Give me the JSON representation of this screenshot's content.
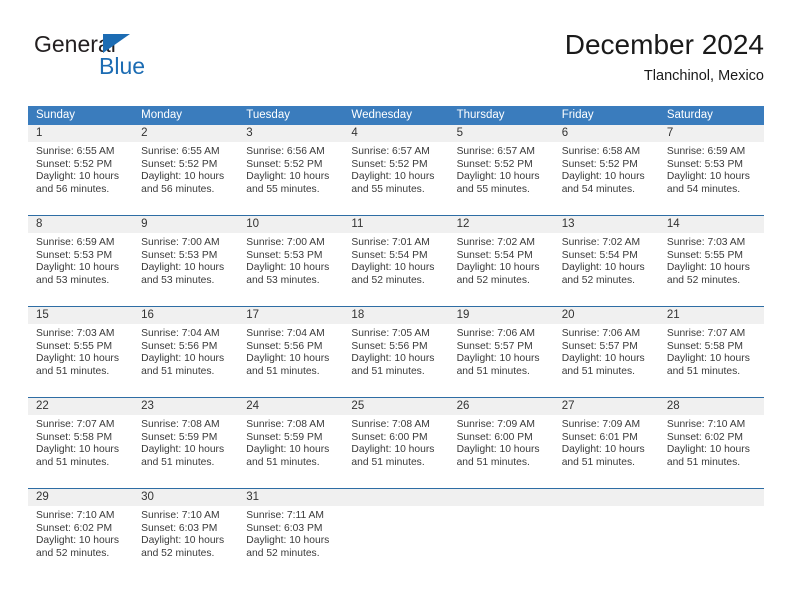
{
  "brand": {
    "name_part1": "General",
    "name_part2": "Blue",
    "triangle_color": "#1c6cb3"
  },
  "header": {
    "title": "December 2024",
    "subtitle": "Tlanchinol, Mexico"
  },
  "theme": {
    "header_blue": "#3a7cbd",
    "divider_blue": "#2e6da4",
    "daynum_band": "#f0f0f0"
  },
  "calendar": {
    "weekday_headers": [
      "Sunday",
      "Monday",
      "Tuesday",
      "Wednesday",
      "Thursday",
      "Friday",
      "Saturday"
    ],
    "weeks": [
      [
        {
          "day": "1",
          "sunrise": "Sunrise: 6:55 AM",
          "sunset": "Sunset: 5:52 PM",
          "daylight1": "Daylight: 10 hours",
          "daylight2": "and 56 minutes."
        },
        {
          "day": "2",
          "sunrise": "Sunrise: 6:55 AM",
          "sunset": "Sunset: 5:52 PM",
          "daylight1": "Daylight: 10 hours",
          "daylight2": "and 56 minutes."
        },
        {
          "day": "3",
          "sunrise": "Sunrise: 6:56 AM",
          "sunset": "Sunset: 5:52 PM",
          "daylight1": "Daylight: 10 hours",
          "daylight2": "and 55 minutes."
        },
        {
          "day": "4",
          "sunrise": "Sunrise: 6:57 AM",
          "sunset": "Sunset: 5:52 PM",
          "daylight1": "Daylight: 10 hours",
          "daylight2": "and 55 minutes."
        },
        {
          "day": "5",
          "sunrise": "Sunrise: 6:57 AM",
          "sunset": "Sunset: 5:52 PM",
          "daylight1": "Daylight: 10 hours",
          "daylight2": "and 55 minutes."
        },
        {
          "day": "6",
          "sunrise": "Sunrise: 6:58 AM",
          "sunset": "Sunset: 5:52 PM",
          "daylight1": "Daylight: 10 hours",
          "daylight2": "and 54 minutes."
        },
        {
          "day": "7",
          "sunrise": "Sunrise: 6:59 AM",
          "sunset": "Sunset: 5:53 PM",
          "daylight1": "Daylight: 10 hours",
          "daylight2": "and 54 minutes."
        }
      ],
      [
        {
          "day": "8",
          "sunrise": "Sunrise: 6:59 AM",
          "sunset": "Sunset: 5:53 PM",
          "daylight1": "Daylight: 10 hours",
          "daylight2": "and 53 minutes."
        },
        {
          "day": "9",
          "sunrise": "Sunrise: 7:00 AM",
          "sunset": "Sunset: 5:53 PM",
          "daylight1": "Daylight: 10 hours",
          "daylight2": "and 53 minutes."
        },
        {
          "day": "10",
          "sunrise": "Sunrise: 7:00 AM",
          "sunset": "Sunset: 5:53 PM",
          "daylight1": "Daylight: 10 hours",
          "daylight2": "and 53 minutes."
        },
        {
          "day": "11",
          "sunrise": "Sunrise: 7:01 AM",
          "sunset": "Sunset: 5:54 PM",
          "daylight1": "Daylight: 10 hours",
          "daylight2": "and 52 minutes."
        },
        {
          "day": "12",
          "sunrise": "Sunrise: 7:02 AM",
          "sunset": "Sunset: 5:54 PM",
          "daylight1": "Daylight: 10 hours",
          "daylight2": "and 52 minutes."
        },
        {
          "day": "13",
          "sunrise": "Sunrise: 7:02 AM",
          "sunset": "Sunset: 5:54 PM",
          "daylight1": "Daylight: 10 hours",
          "daylight2": "and 52 minutes."
        },
        {
          "day": "14",
          "sunrise": "Sunrise: 7:03 AM",
          "sunset": "Sunset: 5:55 PM",
          "daylight1": "Daylight: 10 hours",
          "daylight2": "and 52 minutes."
        }
      ],
      [
        {
          "day": "15",
          "sunrise": "Sunrise: 7:03 AM",
          "sunset": "Sunset: 5:55 PM",
          "daylight1": "Daylight: 10 hours",
          "daylight2": "and 51 minutes."
        },
        {
          "day": "16",
          "sunrise": "Sunrise: 7:04 AM",
          "sunset": "Sunset: 5:56 PM",
          "daylight1": "Daylight: 10 hours",
          "daylight2": "and 51 minutes."
        },
        {
          "day": "17",
          "sunrise": "Sunrise: 7:04 AM",
          "sunset": "Sunset: 5:56 PM",
          "daylight1": "Daylight: 10 hours",
          "daylight2": "and 51 minutes."
        },
        {
          "day": "18",
          "sunrise": "Sunrise: 7:05 AM",
          "sunset": "Sunset: 5:56 PM",
          "daylight1": "Daylight: 10 hours",
          "daylight2": "and 51 minutes."
        },
        {
          "day": "19",
          "sunrise": "Sunrise: 7:06 AM",
          "sunset": "Sunset: 5:57 PM",
          "daylight1": "Daylight: 10 hours",
          "daylight2": "and 51 minutes."
        },
        {
          "day": "20",
          "sunrise": "Sunrise: 7:06 AM",
          "sunset": "Sunset: 5:57 PM",
          "daylight1": "Daylight: 10 hours",
          "daylight2": "and 51 minutes."
        },
        {
          "day": "21",
          "sunrise": "Sunrise: 7:07 AM",
          "sunset": "Sunset: 5:58 PM",
          "daylight1": "Daylight: 10 hours",
          "daylight2": "and 51 minutes."
        }
      ],
      [
        {
          "day": "22",
          "sunrise": "Sunrise: 7:07 AM",
          "sunset": "Sunset: 5:58 PM",
          "daylight1": "Daylight: 10 hours",
          "daylight2": "and 51 minutes."
        },
        {
          "day": "23",
          "sunrise": "Sunrise: 7:08 AM",
          "sunset": "Sunset: 5:59 PM",
          "daylight1": "Daylight: 10 hours",
          "daylight2": "and 51 minutes."
        },
        {
          "day": "24",
          "sunrise": "Sunrise: 7:08 AM",
          "sunset": "Sunset: 5:59 PM",
          "daylight1": "Daylight: 10 hours",
          "daylight2": "and 51 minutes."
        },
        {
          "day": "25",
          "sunrise": "Sunrise: 7:08 AM",
          "sunset": "Sunset: 6:00 PM",
          "daylight1": "Daylight: 10 hours",
          "daylight2": "and 51 minutes."
        },
        {
          "day": "26",
          "sunrise": "Sunrise: 7:09 AM",
          "sunset": "Sunset: 6:00 PM",
          "daylight1": "Daylight: 10 hours",
          "daylight2": "and 51 minutes."
        },
        {
          "day": "27",
          "sunrise": "Sunrise: 7:09 AM",
          "sunset": "Sunset: 6:01 PM",
          "daylight1": "Daylight: 10 hours",
          "daylight2": "and 51 minutes."
        },
        {
          "day": "28",
          "sunrise": "Sunrise: 7:10 AM",
          "sunset": "Sunset: 6:02 PM",
          "daylight1": "Daylight: 10 hours",
          "daylight2": "and 51 minutes."
        }
      ],
      [
        {
          "day": "29",
          "sunrise": "Sunrise: 7:10 AM",
          "sunset": "Sunset: 6:02 PM",
          "daylight1": "Daylight: 10 hours",
          "daylight2": "and 52 minutes."
        },
        {
          "day": "30",
          "sunrise": "Sunrise: 7:10 AM",
          "sunset": "Sunset: 6:03 PM",
          "daylight1": "Daylight: 10 hours",
          "daylight2": "and 52 minutes."
        },
        {
          "day": "31",
          "sunrise": "Sunrise: 7:11 AM",
          "sunset": "Sunset: 6:03 PM",
          "daylight1": "Daylight: 10 hours",
          "daylight2": "and 52 minutes."
        },
        {
          "day": "",
          "sunrise": "",
          "sunset": "",
          "daylight1": "",
          "daylight2": ""
        },
        {
          "day": "",
          "sunrise": "",
          "sunset": "",
          "daylight1": "",
          "daylight2": ""
        },
        {
          "day": "",
          "sunrise": "",
          "sunset": "",
          "daylight1": "",
          "daylight2": ""
        },
        {
          "day": "",
          "sunrise": "",
          "sunset": "",
          "daylight1": "",
          "daylight2": ""
        }
      ]
    ]
  }
}
